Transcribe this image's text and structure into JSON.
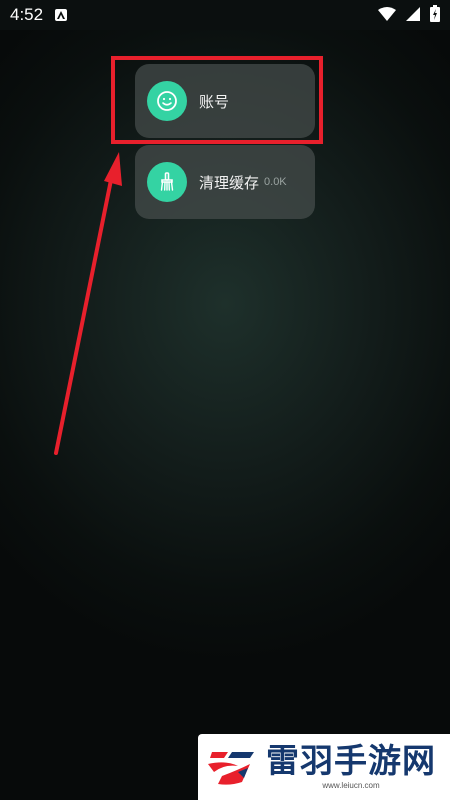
{
  "status_bar": {
    "time": "4:52"
  },
  "menu": {
    "items": [
      {
        "label": "账号",
        "icon": "smiley-face-icon"
      },
      {
        "label": "清理缓存",
        "sub": "0.0K",
        "icon": "broom-icon"
      }
    ]
  },
  "colors": {
    "accent": "#34d3a3",
    "highlight": "#e8202c",
    "card_bg": "#464e4c"
  },
  "watermark": {
    "title": "雷羽手游网",
    "url": "www.leiucn.com"
  }
}
